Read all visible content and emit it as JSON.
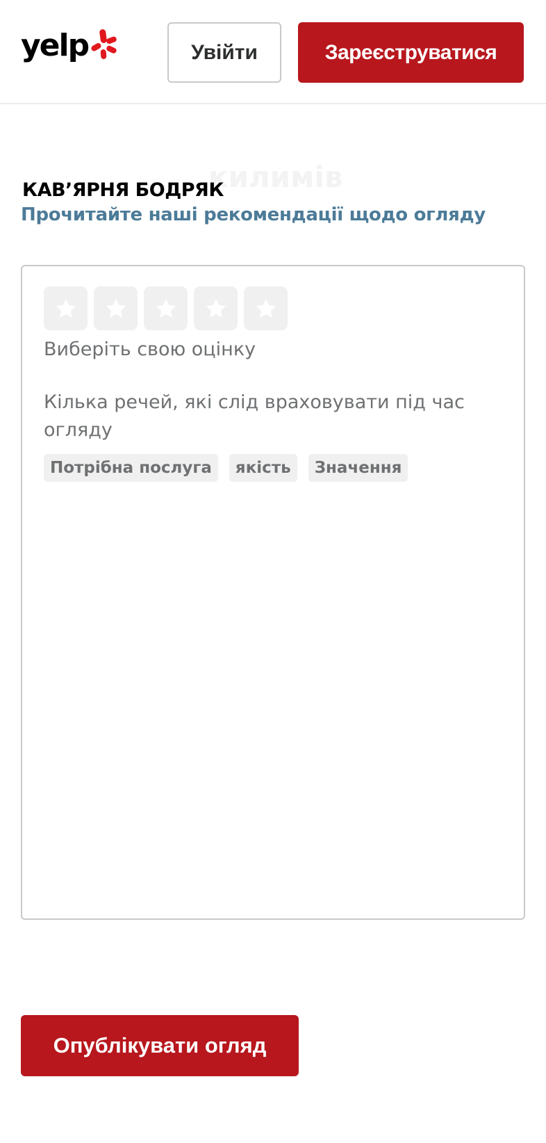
{
  "header": {
    "logo_text": "yelp",
    "login_label": "Увійти",
    "signup_label": "Зареєструватися"
  },
  "business": {
    "name": "КАВ’ЯРНЯ БОДРЯК",
    "ghost_text": "килимів"
  },
  "guidelines_link": "Прочитайте наші рекомендації щодо огляду",
  "review": {
    "star_count": 5,
    "rating_prompt": "Виберіть свою оцінку",
    "consider_text": "Кілька речей, які слід враховувати під час огляду",
    "tags": [
      "Потрібна послуга",
      "якість",
      "Значення"
    ]
  },
  "post_button_label": "Опублікувати огляд",
  "colors": {
    "brand_red": "#b7171d",
    "link_blue": "#4c7b98",
    "star_background": "#f0f0f0"
  },
  "icons": {
    "logo_burst": "yelp-burst-icon",
    "star": "star-icon"
  }
}
